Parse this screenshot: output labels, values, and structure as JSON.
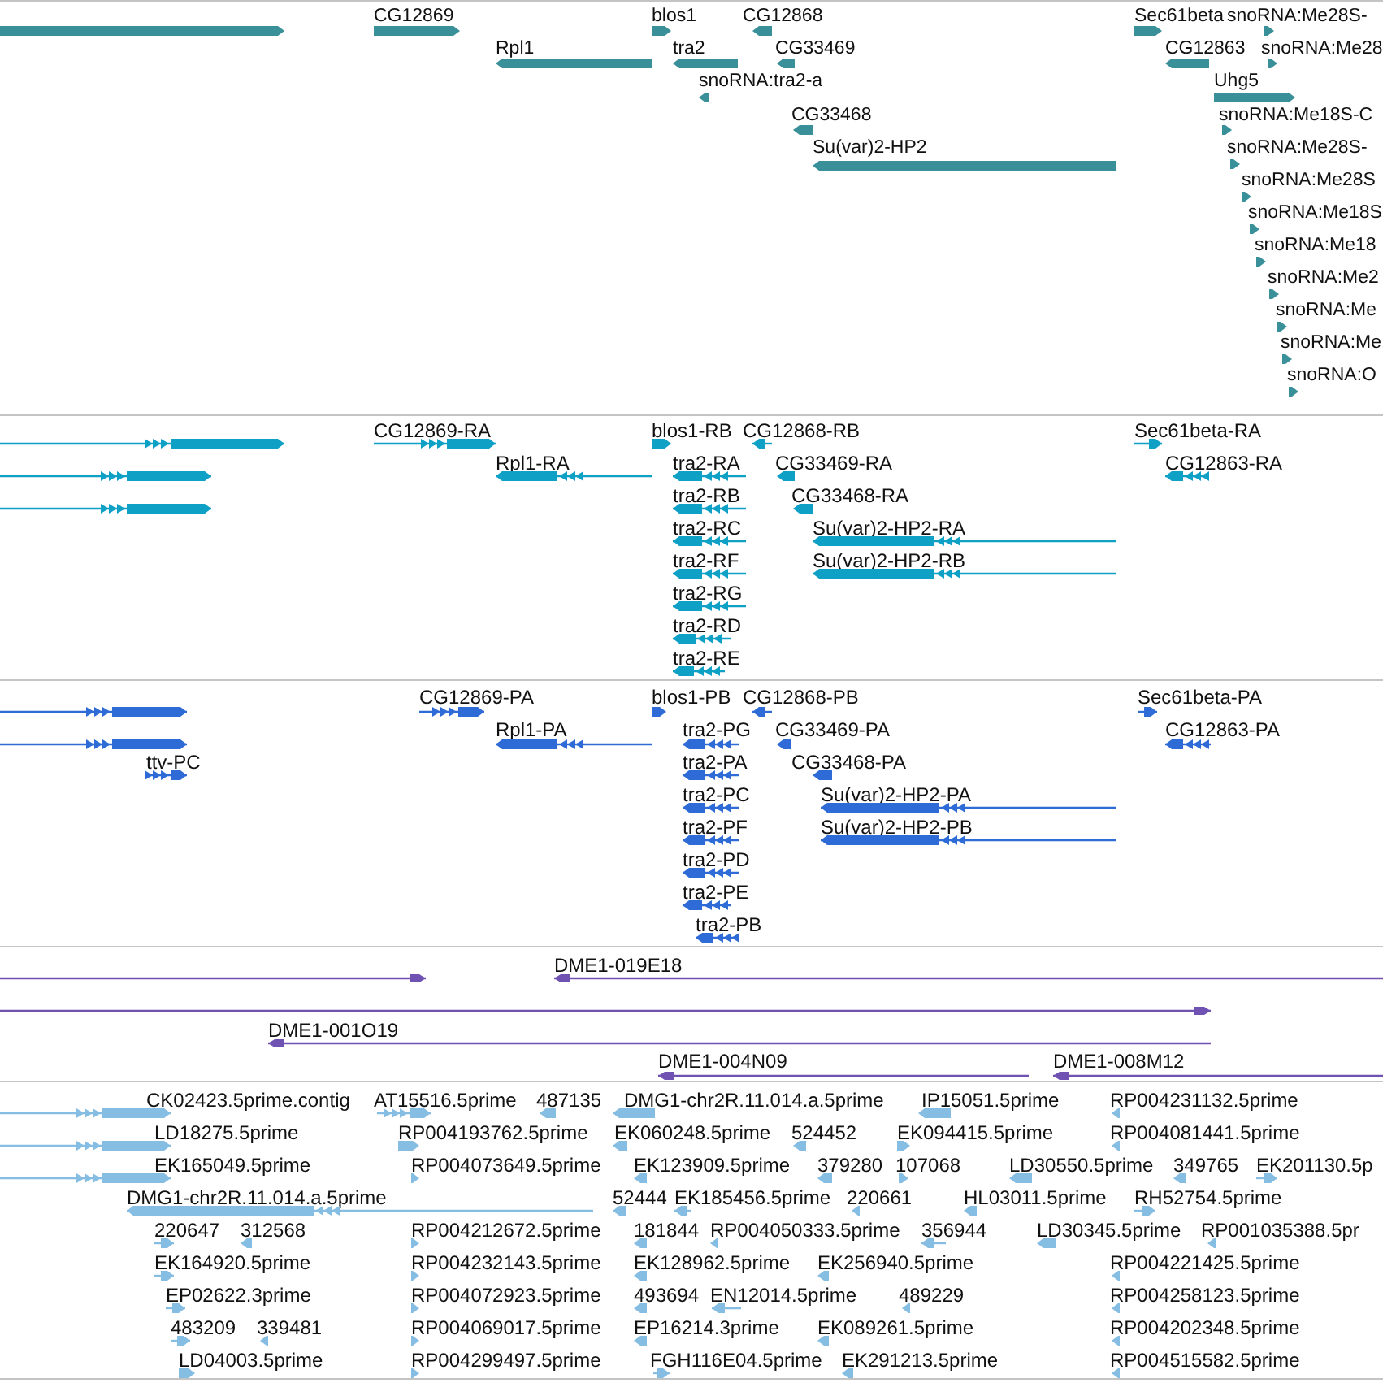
{
  "tracks": [
    {
      "color": "#3a9099",
      "features": [
        {
          "reverse": false
        },
        {
          "label": "CG12869",
          "reverse": false
        },
        {
          "label": "Rpl1",
          "reverse": true
        },
        {
          "label": "blos1",
          "reverse": false
        },
        {
          "label": "CG12868",
          "reverse": true
        },
        {
          "label": "tra2",
          "reverse": true
        },
        {
          "label": "CG33469",
          "reverse": true
        },
        {
          "label": "snoRNA:tra2-a",
          "reverse": true
        },
        {
          "label": "CG33468",
          "reverse": true
        },
        {
          "label": "Su(var)2-HP2",
          "reverse": true
        },
        {
          "label": "Sec61beta",
          "reverse": false
        },
        {
          "label": "snoRNA:Me28S-",
          "reverse": false
        },
        {
          "label": "CG12863",
          "reverse": true
        },
        {
          "label": "snoRNA:Me28",
          "reverse": false
        },
        {
          "label": "Uhg5",
          "reverse": false
        },
        {
          "label": "snoRNA:Me18S-C",
          "reverse": false
        },
        {
          "label": "snoRNA:Me28S-",
          "reverse": false
        },
        {
          "label": "snoRNA:Me28S",
          "reverse": false
        },
        {
          "label": "snoRNA:Me18S",
          "reverse": false
        },
        {
          "label": "snoRNA:Me18",
          "reverse": false
        },
        {
          "label": "snoRNA:Me2",
          "reverse": false
        },
        {
          "label": "snoRNA:Me",
          "reverse": false
        },
        {
          "label": "snoRNA:Me",
          "reverse": false
        },
        {
          "label": "snoRNA:O",
          "reverse": false
        }
      ]
    },
    {
      "color": "#0fa0c6",
      "features": [
        {
          "reverse": false
        },
        {
          "reverse": false
        },
        {
          "reverse": false
        },
        {
          "label": "CG12869-RA",
          "reverse": false
        },
        {
          "label": "Rpl1-RA",
          "reverse": true
        },
        {
          "label": "blos1-RB",
          "reverse": false
        },
        {
          "label": "CG12868-RB",
          "reverse": true
        },
        {
          "label": "tra2-RA",
          "reverse": true
        },
        {
          "label": "tra2-RB",
          "reverse": true
        },
        {
          "label": "tra2-RC",
          "reverse": true
        },
        {
          "label": "tra2-RF",
          "reverse": true
        },
        {
          "label": "tra2-RG",
          "reverse": true
        },
        {
          "label": "tra2-RD",
          "reverse": true
        },
        {
          "label": "tra2-RE",
          "reverse": true
        },
        {
          "label": "CG33469-RA",
          "reverse": true
        },
        {
          "label": "CG33468-RA",
          "reverse": true
        },
        {
          "label": "Su(var)2-HP2-RA",
          "reverse": true
        },
        {
          "label": "Su(var)2-HP2-RB",
          "reverse": true
        },
        {
          "label": "Sec61beta-RA",
          "reverse": false
        },
        {
          "label": "CG12863-RA",
          "reverse": true
        }
      ]
    },
    {
      "color": "#2e6bd6",
      "features": [
        {
          "reverse": false
        },
        {
          "reverse": false
        },
        {
          "label": "ttv-PC",
          "reverse": false
        },
        {
          "label": "CG12869-PA",
          "reverse": false
        },
        {
          "label": "Rpl1-PA",
          "reverse": true
        },
        {
          "label": "blos1-PB",
          "reverse": false
        },
        {
          "label": "CG12868-PB",
          "reverse": true
        },
        {
          "label": "tra2-PG",
          "reverse": true
        },
        {
          "label": "tra2-PA",
          "reverse": true
        },
        {
          "label": "tra2-PC",
          "reverse": true
        },
        {
          "label": "tra2-PF",
          "reverse": true
        },
        {
          "label": "tra2-PD",
          "reverse": true
        },
        {
          "label": "tra2-PE",
          "reverse": true
        },
        {
          "label": "tra2-PB",
          "reverse": true
        },
        {
          "label": "CG33469-PA",
          "reverse": true
        },
        {
          "label": "CG33468-PA",
          "reverse": true
        },
        {
          "label": "Su(var)2-HP2-PA",
          "reverse": true
        },
        {
          "label": "Su(var)2-HP2-PB",
          "reverse": true
        },
        {
          "label": "Sec61beta-PA",
          "reverse": false
        },
        {
          "label": "CG12863-PA",
          "reverse": true
        }
      ]
    },
    {
      "color": "#7052b3",
      "features": [
        {
          "reverse": false
        },
        {
          "label": "DME1-019E18",
          "reverse": true
        },
        {
          "reverse": false
        },
        {
          "label": "DME1-001O19",
          "reverse": true
        },
        {
          "label": "DME1-004N09",
          "reverse": true
        },
        {
          "label": "DME1-008M12",
          "reverse": true
        }
      ]
    },
    {
      "color": "#86bde3",
      "features": [
        {
          "label": "CK02423.5prime.contig",
          "reverse": false
        },
        {
          "label": "AT15516.5prime",
          "reverse": false
        },
        {
          "label": "487135",
          "reverse": true
        },
        {
          "label": "DMG1-chr2R.11.014.a.5prime",
          "reverse": true
        },
        {
          "label": "IP15051.5prime",
          "reverse": true
        },
        {
          "label": "RP004231132.5prime",
          "reverse": true
        },
        {
          "label": "LD18275.5prime",
          "reverse": false
        },
        {
          "label": "RP004193762.5prime",
          "reverse": false
        },
        {
          "label": "EK060248.5prime",
          "reverse": true
        },
        {
          "label": "524452",
          "reverse": true
        },
        {
          "label": "EK094415.5prime",
          "reverse": false
        },
        {
          "label": "RP004081441.5prime",
          "reverse": true
        },
        {
          "label": "EK165049.5prime",
          "reverse": false
        },
        {
          "label": "RP004073649.5prime",
          "reverse": false
        },
        {
          "label": "EK123909.5prime",
          "reverse": true
        },
        {
          "label": "379280",
          "reverse": true
        },
        {
          "label": "107068",
          "reverse": false
        },
        {
          "label": "LD30550.5prime",
          "reverse": true
        },
        {
          "label": "349765",
          "reverse": true
        },
        {
          "label": "EK201130.5p",
          "reverse": false
        },
        {
          "label": "DMG1-chr2R.11.014.a.5prime",
          "reverse": true
        },
        {
          "label": "52444",
          "reverse": true
        },
        {
          "label": "EK185456.5prime",
          "reverse": true
        },
        {
          "label": "220661",
          "reverse": true
        },
        {
          "label": "HL03011.5prime",
          "reverse": true
        },
        {
          "label": "RH52754.5prime",
          "reverse": false
        },
        {
          "label": "220647",
          "reverse": false
        },
        {
          "label": "312568",
          "reverse": true
        },
        {
          "label": "RP004212672.5prime",
          "reverse": false
        },
        {
          "label": "181844",
          "reverse": true
        },
        {
          "label": "RP004050333.5prime",
          "reverse": true
        },
        {
          "label": "356944",
          "reverse": true
        },
        {
          "label": "LD30345.5prime",
          "reverse": true
        },
        {
          "label": "RP001035388.5pr",
          "reverse": true
        },
        {
          "label": "EK164920.5prime",
          "reverse": false
        },
        {
          "label": "RP004232143.5prime",
          "reverse": false
        },
        {
          "label": "EK128962.5prime",
          "reverse": true
        },
        {
          "label": "EK256940.5prime",
          "reverse": true
        },
        {
          "label": "RP004221425.5prime",
          "reverse": true
        },
        {
          "label": "EP02622.3prime",
          "reverse": false
        },
        {
          "label": "RP004072923.5prime",
          "reverse": false
        },
        {
          "label": "493694",
          "reverse": true
        },
        {
          "label": "EN12014.5prime",
          "reverse": true
        },
        {
          "label": "489229",
          "reverse": true
        },
        {
          "label": "RP004258123.5prime",
          "reverse": true
        },
        {
          "label": "483209",
          "reverse": false
        },
        {
          "label": "339481",
          "reverse": true
        },
        {
          "label": "RP004069017.5prime",
          "reverse": false
        },
        {
          "label": "EP16214.3prime",
          "reverse": true
        },
        {
          "label": "EK089261.5prime",
          "reverse": true
        },
        {
          "label": "RP004202348.5prime",
          "reverse": true
        },
        {
          "label": "LD04003.5prime",
          "reverse": false
        },
        {
          "label": "RP004299497.5prime",
          "reverse": false
        },
        {
          "label": "FGH116E04.5prime",
          "reverse": false
        },
        {
          "label": "EK291213.5prime",
          "reverse": true
        },
        {
          "label": "RP004515582.5prime",
          "reverse": true
        }
      ]
    }
  ]
}
